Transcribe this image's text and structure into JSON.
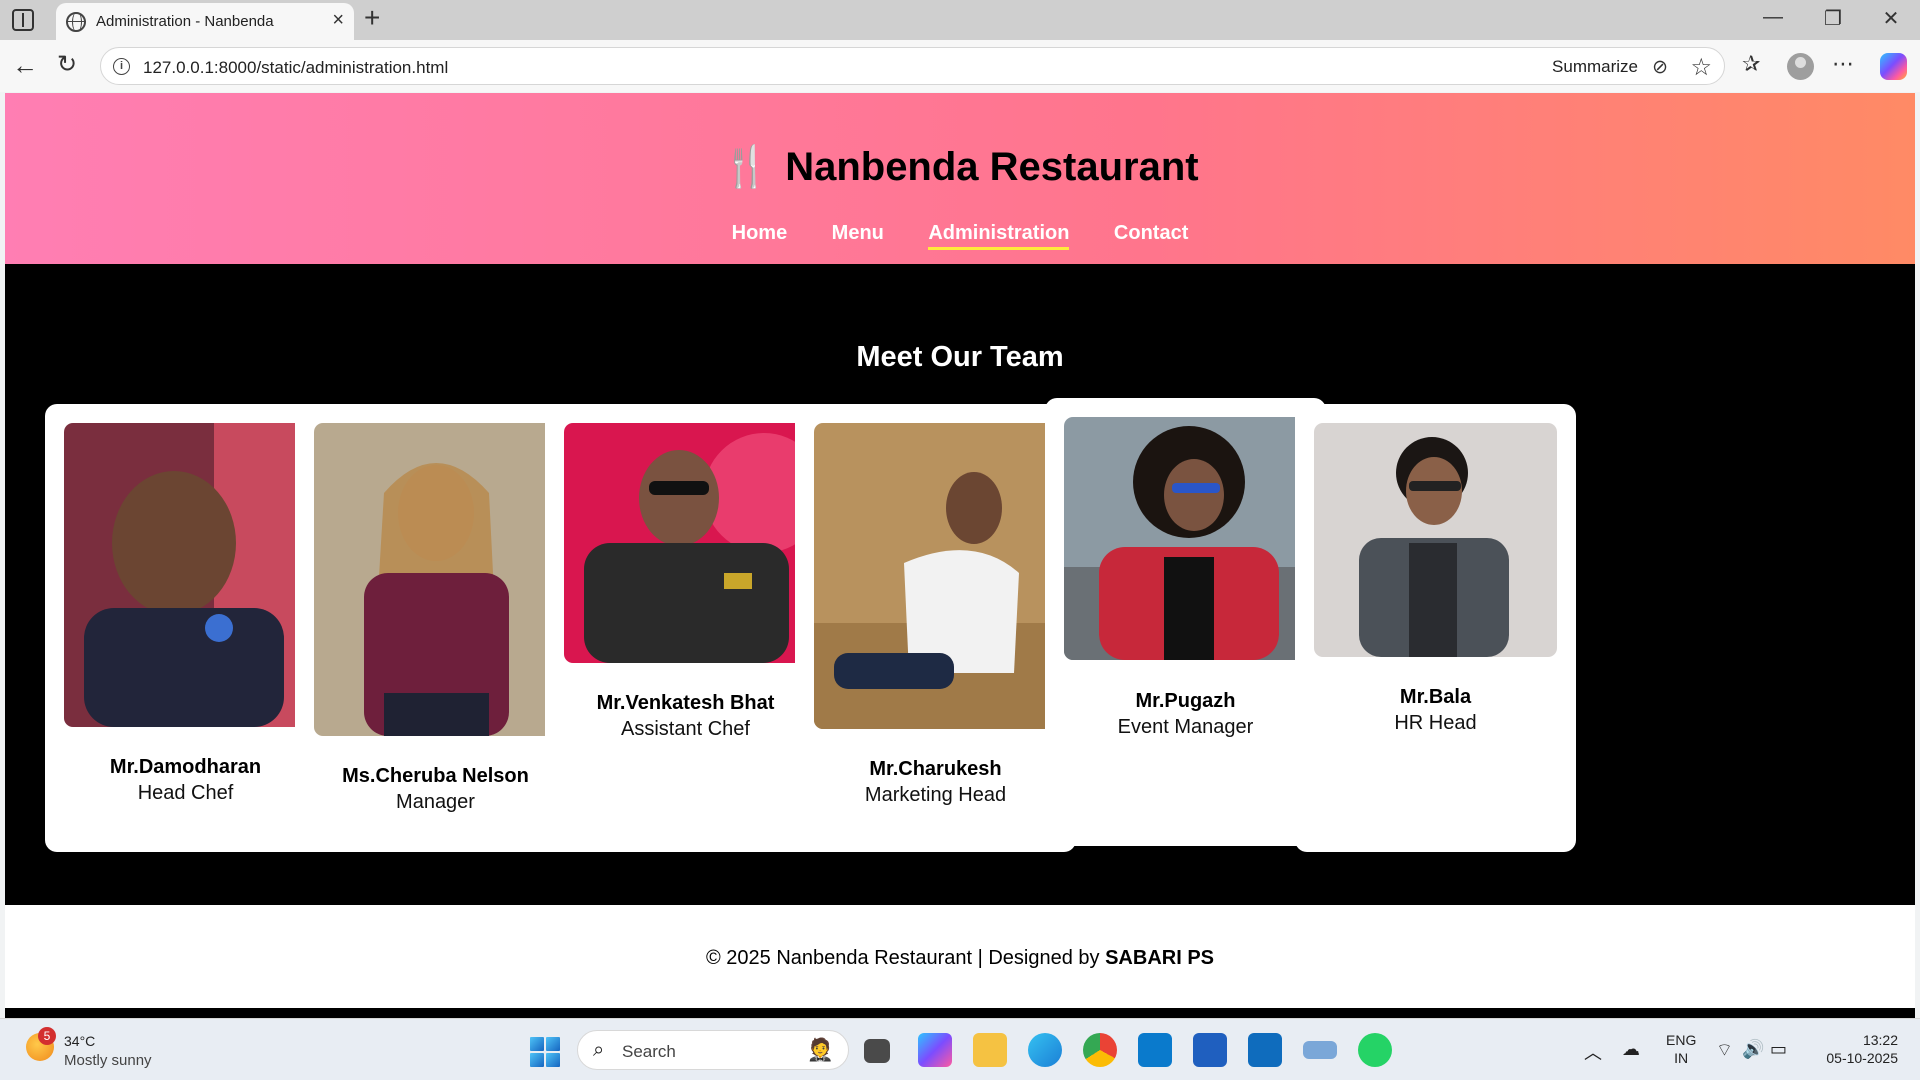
{
  "browser": {
    "tab_title": "Administration - Nanbenda",
    "url": "127.0.0.1:8000/static/administration.html",
    "summarize_label": "Summarize"
  },
  "site": {
    "brand": "Nanbenda Restaurant",
    "brand_icon": "🍴",
    "nav": [
      "Home",
      "Menu",
      "Administration",
      "Contact"
    ],
    "active_nav": "Administration",
    "section_title": "Meet Our Team",
    "team": [
      {
        "name": "Mr.Damodharan",
        "role": "Head Chef"
      },
      {
        "name": "Ms.Cheruba Nelson",
        "role": "Manager"
      },
      {
        "name": "Mr.Venkatesh Bhat",
        "role": "Assistant Chef"
      },
      {
        "name": "Mr.Charukesh",
        "role": "Marketing Head"
      },
      {
        "name": "Mr.Pugazh",
        "role": "Event Manager"
      },
      {
        "name": "Mr.Bala",
        "role": "HR Head"
      }
    ],
    "footer_text": "© 2025 Nanbenda Restaurant | Designed by ",
    "footer_author": "SABARI PS"
  },
  "taskbar": {
    "weather_badge": "5",
    "weather_temp": "34°C",
    "weather_desc": "Mostly sunny",
    "search_label": "Search",
    "lang_top": "ENG",
    "lang_bottom": "IN",
    "time": "13:22",
    "date": "05-10-2025"
  },
  "colors": {
    "header_gradient_start": "#ff7eb3",
    "header_gradient_end": "#ff8a65",
    "active_underline": "#ffeb3b",
    "page_background": "#000000"
  }
}
